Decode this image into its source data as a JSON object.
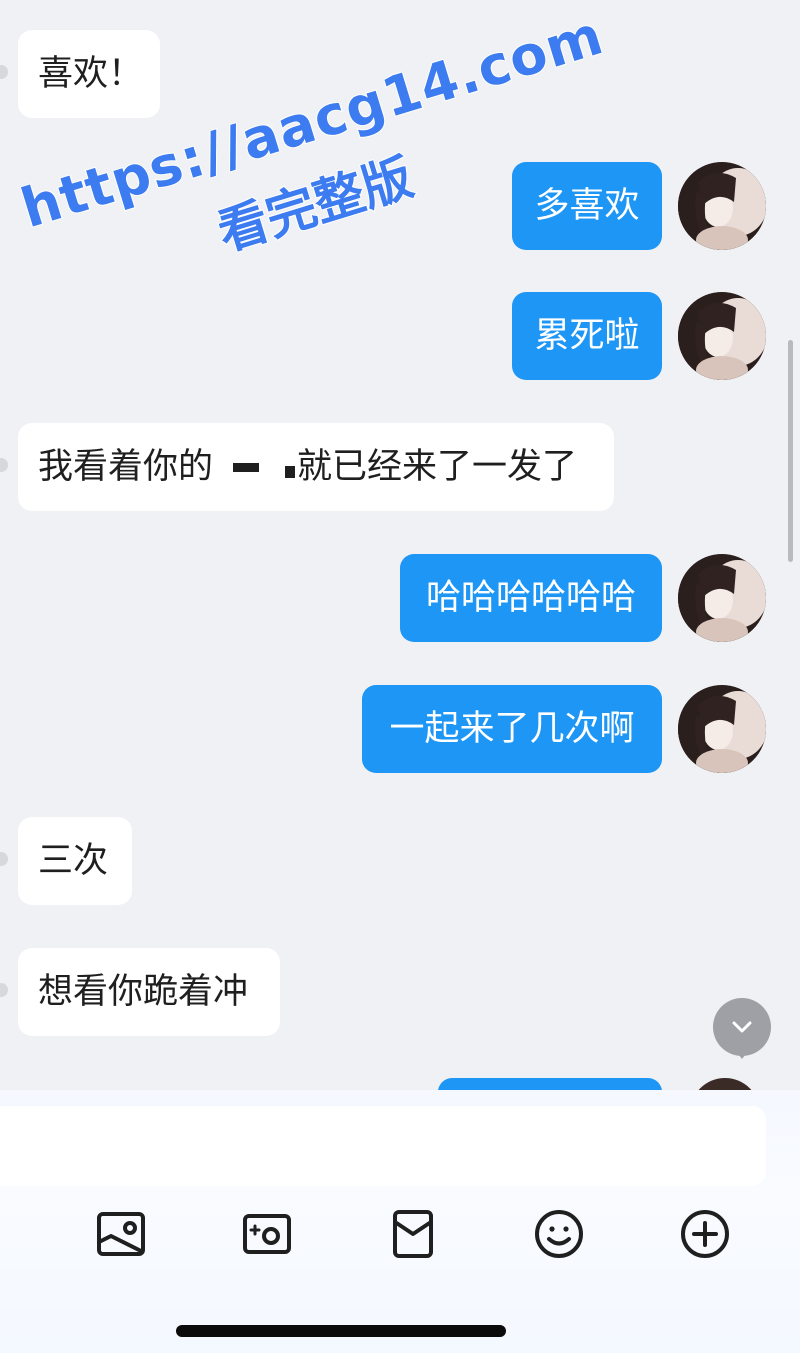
{
  "messages": [
    {
      "id": 1,
      "side": "in",
      "text": "喜欢！"
    },
    {
      "id": 2,
      "side": "out",
      "text": "多喜欢"
    },
    {
      "id": 3,
      "side": "out",
      "text": "累死啦"
    },
    {
      "id": 4,
      "side": "in",
      "text_before": "我看着你的",
      "text_after": "就已经来了一发了"
    },
    {
      "id": 5,
      "side": "out",
      "text": "哈哈哈哈哈哈"
    },
    {
      "id": 6,
      "side": "out",
      "text": "一起来了几次啊"
    },
    {
      "id": 7,
      "side": "in",
      "text": "三次"
    },
    {
      "id": 8,
      "side": "in",
      "text": "想看你跪着冲"
    }
  ],
  "watermark": {
    "url": "https://aacg14.com",
    "caption": "看完整版"
  },
  "input": {
    "value": "",
    "placeholder": ""
  },
  "toolbar": {
    "icons": [
      "image-icon",
      "camera-icon",
      "red-packet-icon",
      "emoji-icon",
      "plus-circle-icon"
    ]
  },
  "colors": {
    "background": "#f0f1f5",
    "outgoing_bubble": "#1e96f5",
    "incoming_bubble": "#ffffff",
    "watermark": "#3d7bf0"
  }
}
